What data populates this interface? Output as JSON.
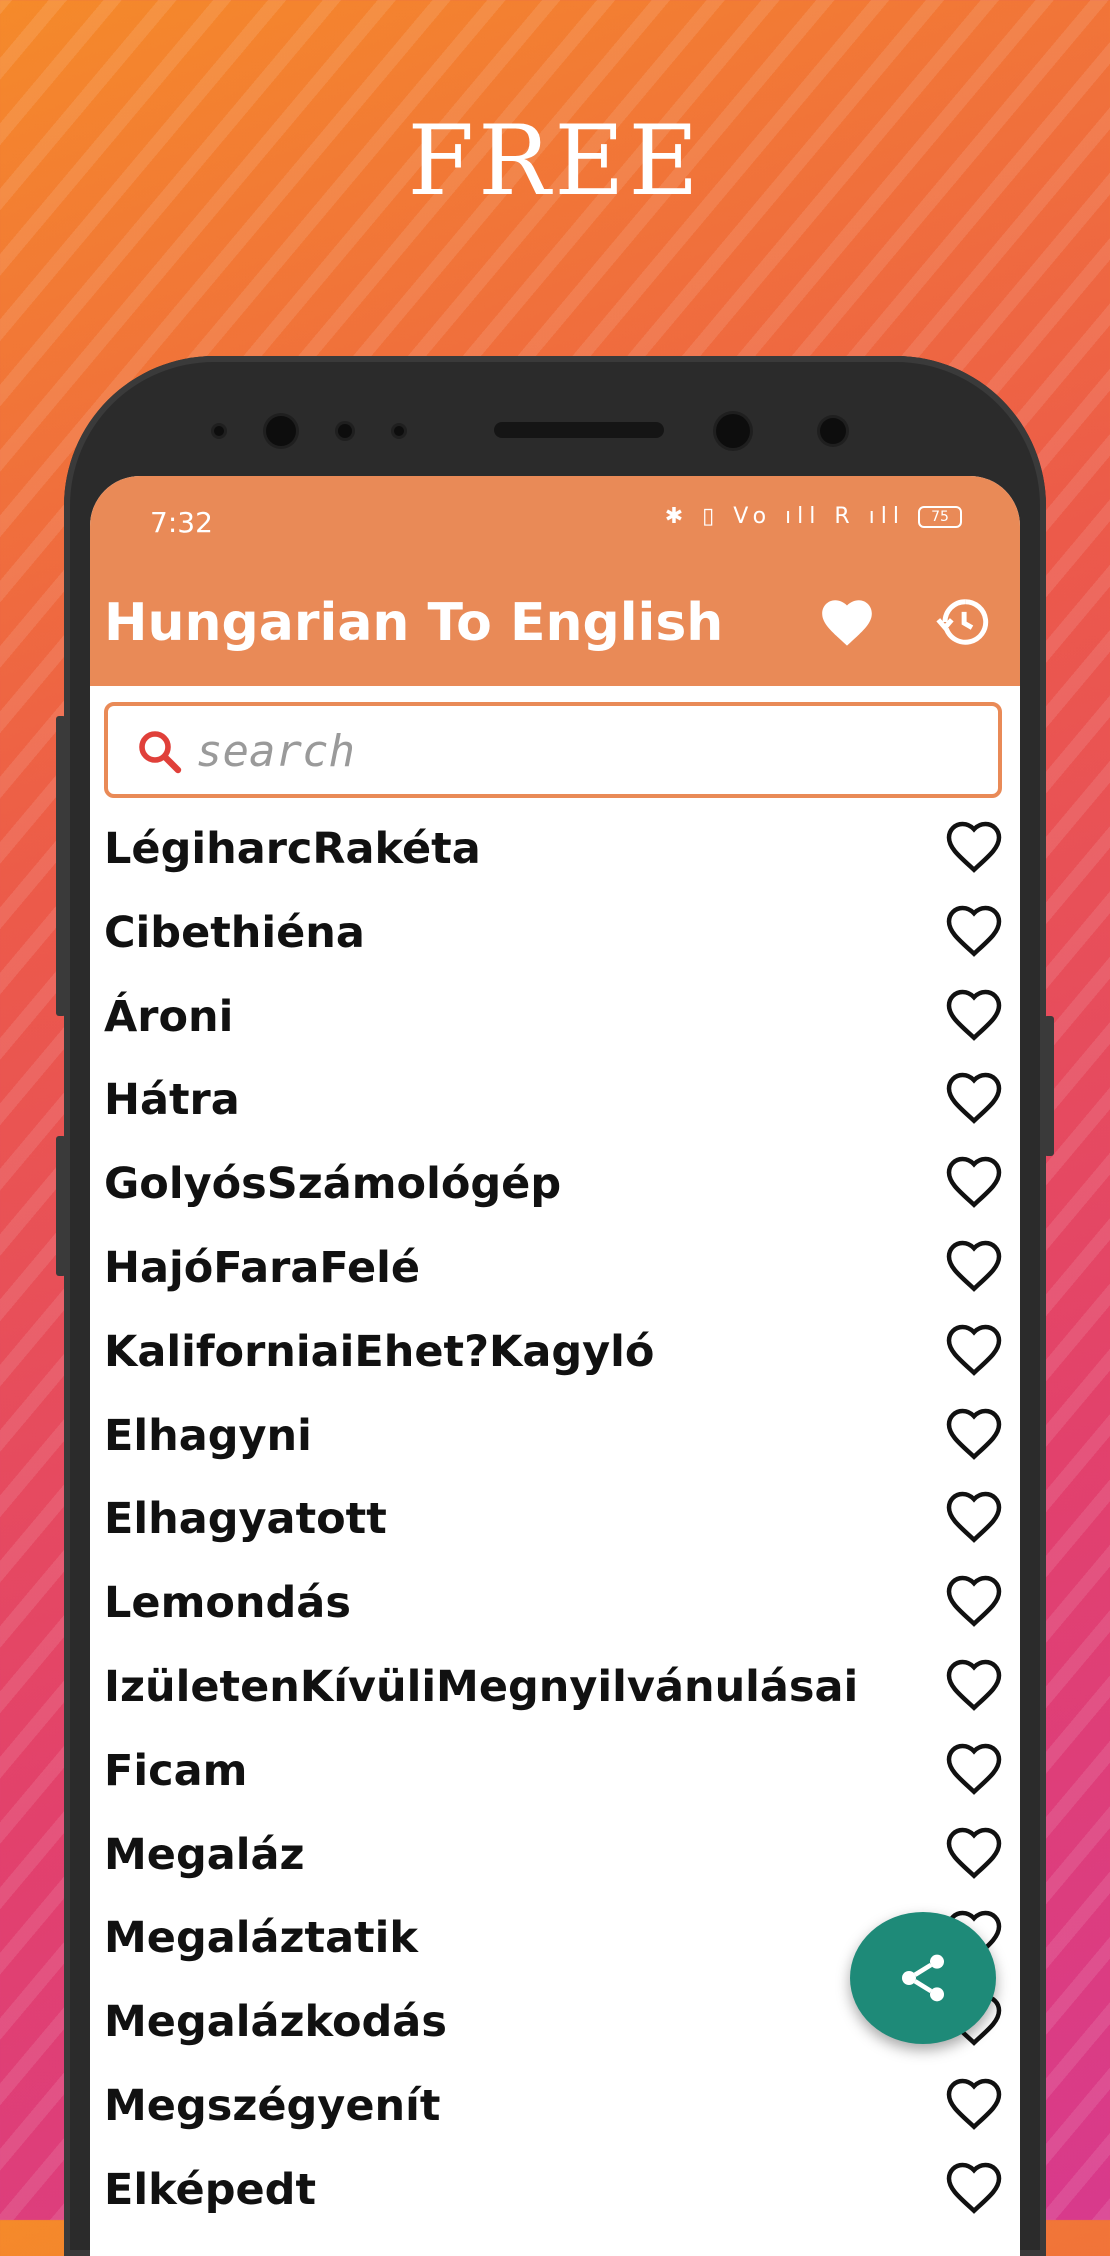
{
  "promo": {
    "title": "FREE"
  },
  "status_bar": {
    "time": "7:32",
    "icons": "✱ ▯ Vo ıll R ıll",
    "battery": "75"
  },
  "app_bar": {
    "title": "Hungarian To English",
    "icons": [
      "heart-filled-icon",
      "history-icon"
    ]
  },
  "search": {
    "placeholder": "search",
    "value": ""
  },
  "words": [
    "LégiharcRakéta",
    "Cibethiéna",
    "Ároni",
    "Hátra",
    "GolyósSzámológép",
    "HajóFaraFelé",
    "KaliforniaiEhet?Kagyló",
    "Elhagyni",
    "Elhagyatott",
    "Lemondás",
    "IzületenKívüliMegnyilvánulásai",
    "Ficam",
    "Megaláz",
    "Megaláztatik",
    "Megalázkodás",
    "Megszégyenít",
    "Elképedt"
  ],
  "colors": {
    "accent": "#e98a57",
    "fab": "#1e8a78"
  },
  "fab": {
    "icon": "share-icon"
  }
}
